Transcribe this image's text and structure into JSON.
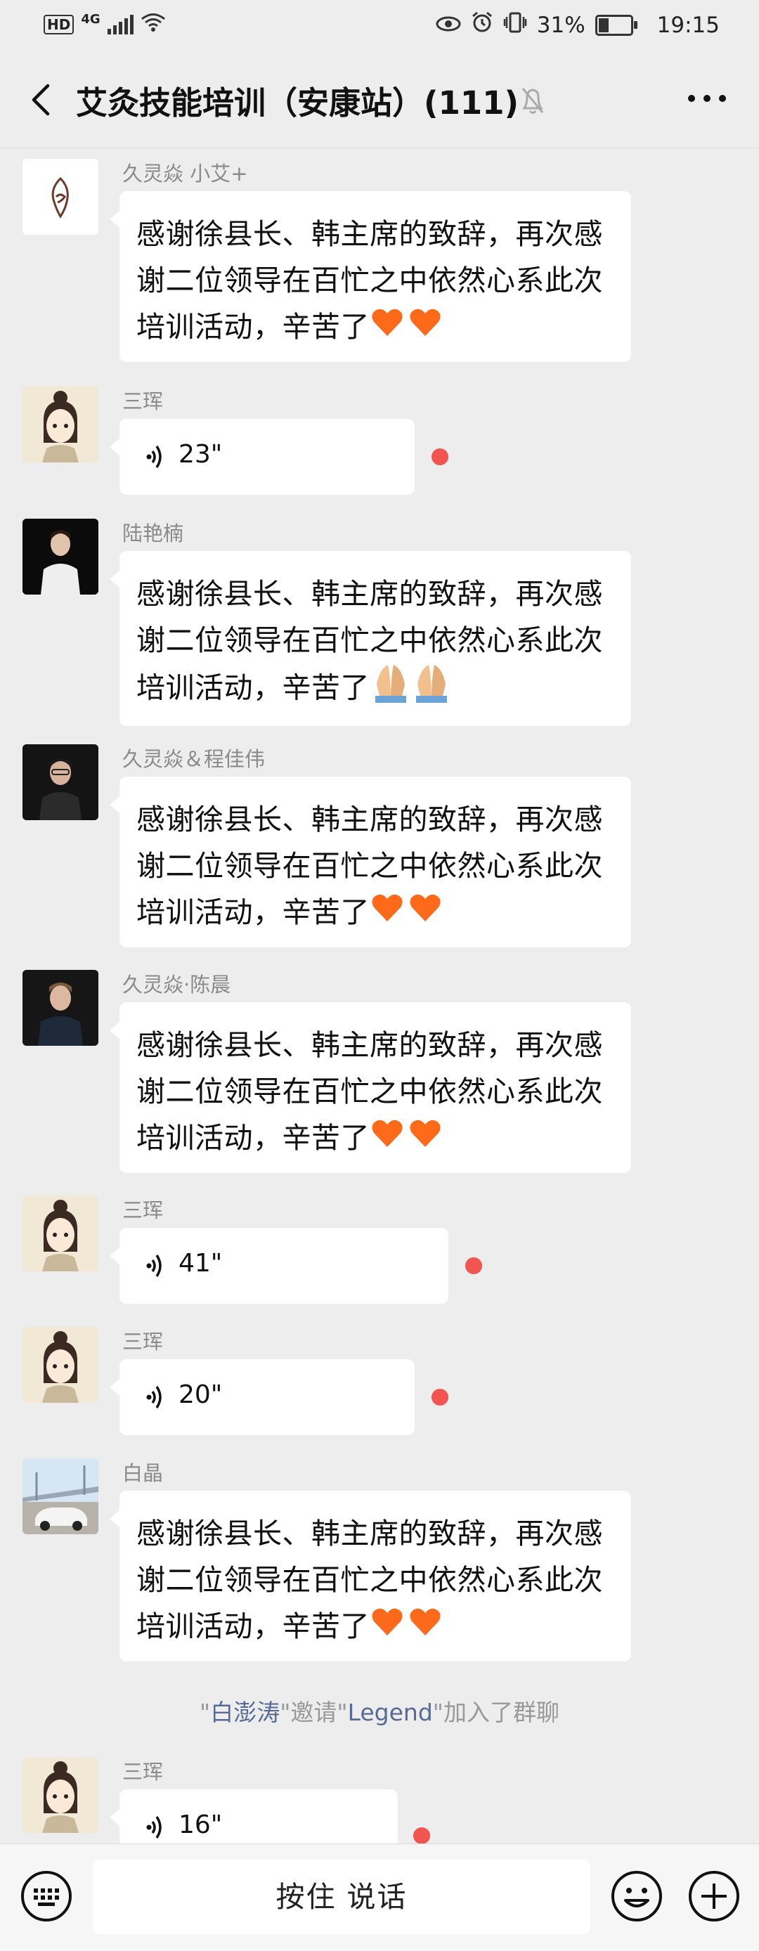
{
  "status_bar": {
    "hd": "HD",
    "network": "4G",
    "battery_text": "31%",
    "battery_level": 0.31,
    "time": "19:15"
  },
  "header": {
    "title": "艾灸技能培训（安康站）(111)",
    "icons": [
      "back-arrow-icon",
      "mute-bell-icon",
      "more-icon"
    ]
  },
  "messages": [
    {
      "sender": "久灵焱 小艾+",
      "type": "text",
      "text": "感谢徐县长、韩主席的致辞，再次感谢二位领导在百忙之中依然心系此次培训活动，辛苦了",
      "emoji": "heart"
    },
    {
      "sender": "三珲",
      "type": "voice",
      "duration": "23\"",
      "unread": true
    },
    {
      "sender": "陆艳楠",
      "type": "text",
      "text": "感谢徐县长、韩主席的致辞，再次感谢二位领导在百忙之中依然心系此次培训活动，辛苦了",
      "emoji": "pray"
    },
    {
      "sender": "久灵焱＆程佳伟",
      "type": "text",
      "text": "感谢徐县长、韩主席的致辞，再次感谢二位领导在百忙之中依然心系此次培训活动，辛苦了",
      "emoji": "heart"
    },
    {
      "sender": "久灵焱·陈晨",
      "type": "text",
      "text": "感谢徐县长、韩主席的致辞，再次感谢二位领导在百忙之中依然心系此次培训活动，辛苦了",
      "emoji": "heart"
    },
    {
      "sender": "三珲",
      "type": "voice",
      "duration": "41\"",
      "unread": true
    },
    {
      "sender": "三珲",
      "type": "voice",
      "duration": "20\"",
      "unread": true
    },
    {
      "sender": "白晶",
      "type": "text",
      "text": "感谢徐县长、韩主席的致辞，再次感谢二位领导在百忙之中依然心系此次培训活动，辛苦了",
      "emoji": "heart"
    },
    {
      "sender": "三珲",
      "type": "voice",
      "duration": "16\"",
      "unread": true
    }
  ],
  "system_message": {
    "quote1": "\"",
    "inviter": "白澎涛",
    "middle": "\"邀请\"",
    "invitee": "Legend",
    "end": "\"加入了群聊"
  },
  "bottom_bar": {
    "hold_to_talk": "按住 说话",
    "icons": [
      "keyboard-icon",
      "emoji-icon",
      "plus-icon"
    ]
  },
  "colors": {
    "background": "#ededed",
    "bubble": "#ffffff",
    "unread_dot": "#f25450",
    "link_name": "#576b95"
  }
}
